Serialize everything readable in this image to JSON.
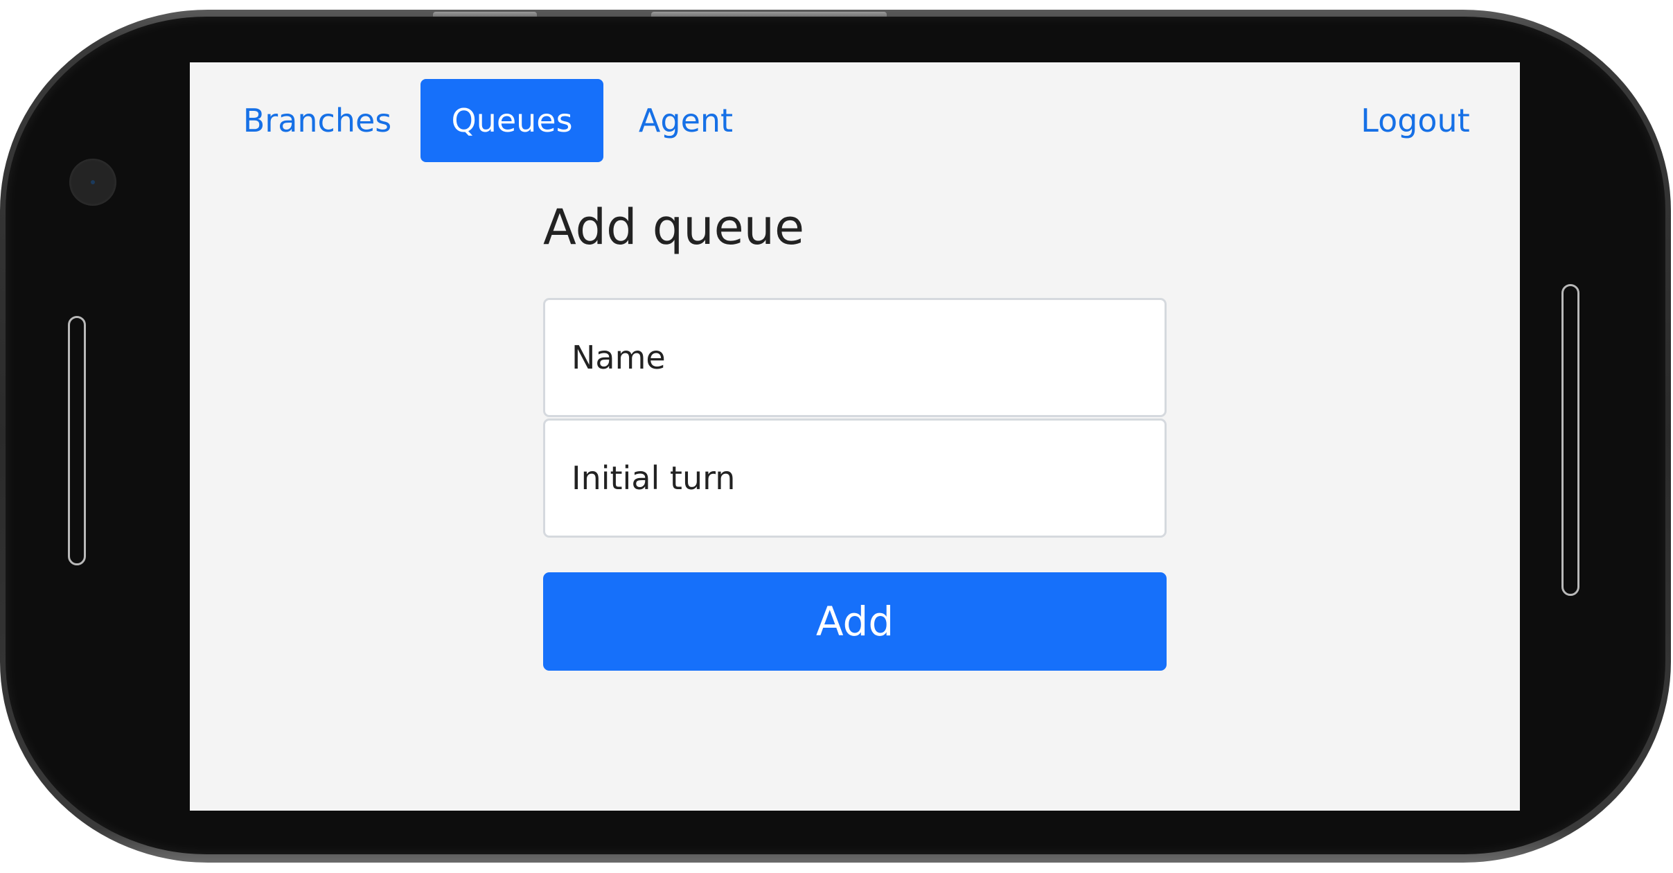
{
  "nav": {
    "items": [
      {
        "label": "Branches",
        "active": false
      },
      {
        "label": "Queues",
        "active": true
      },
      {
        "label": "Agent",
        "active": false
      }
    ],
    "logout_label": "Logout"
  },
  "form": {
    "title": "Add queue",
    "name_placeholder": "Name",
    "initial_turn_placeholder": "Initial turn",
    "submit_label": "Add"
  },
  "colors": {
    "accent": "#1670fa",
    "link": "#1670e6",
    "page_background": "#f4f4f4",
    "device_frame": "#0d0d0d"
  }
}
